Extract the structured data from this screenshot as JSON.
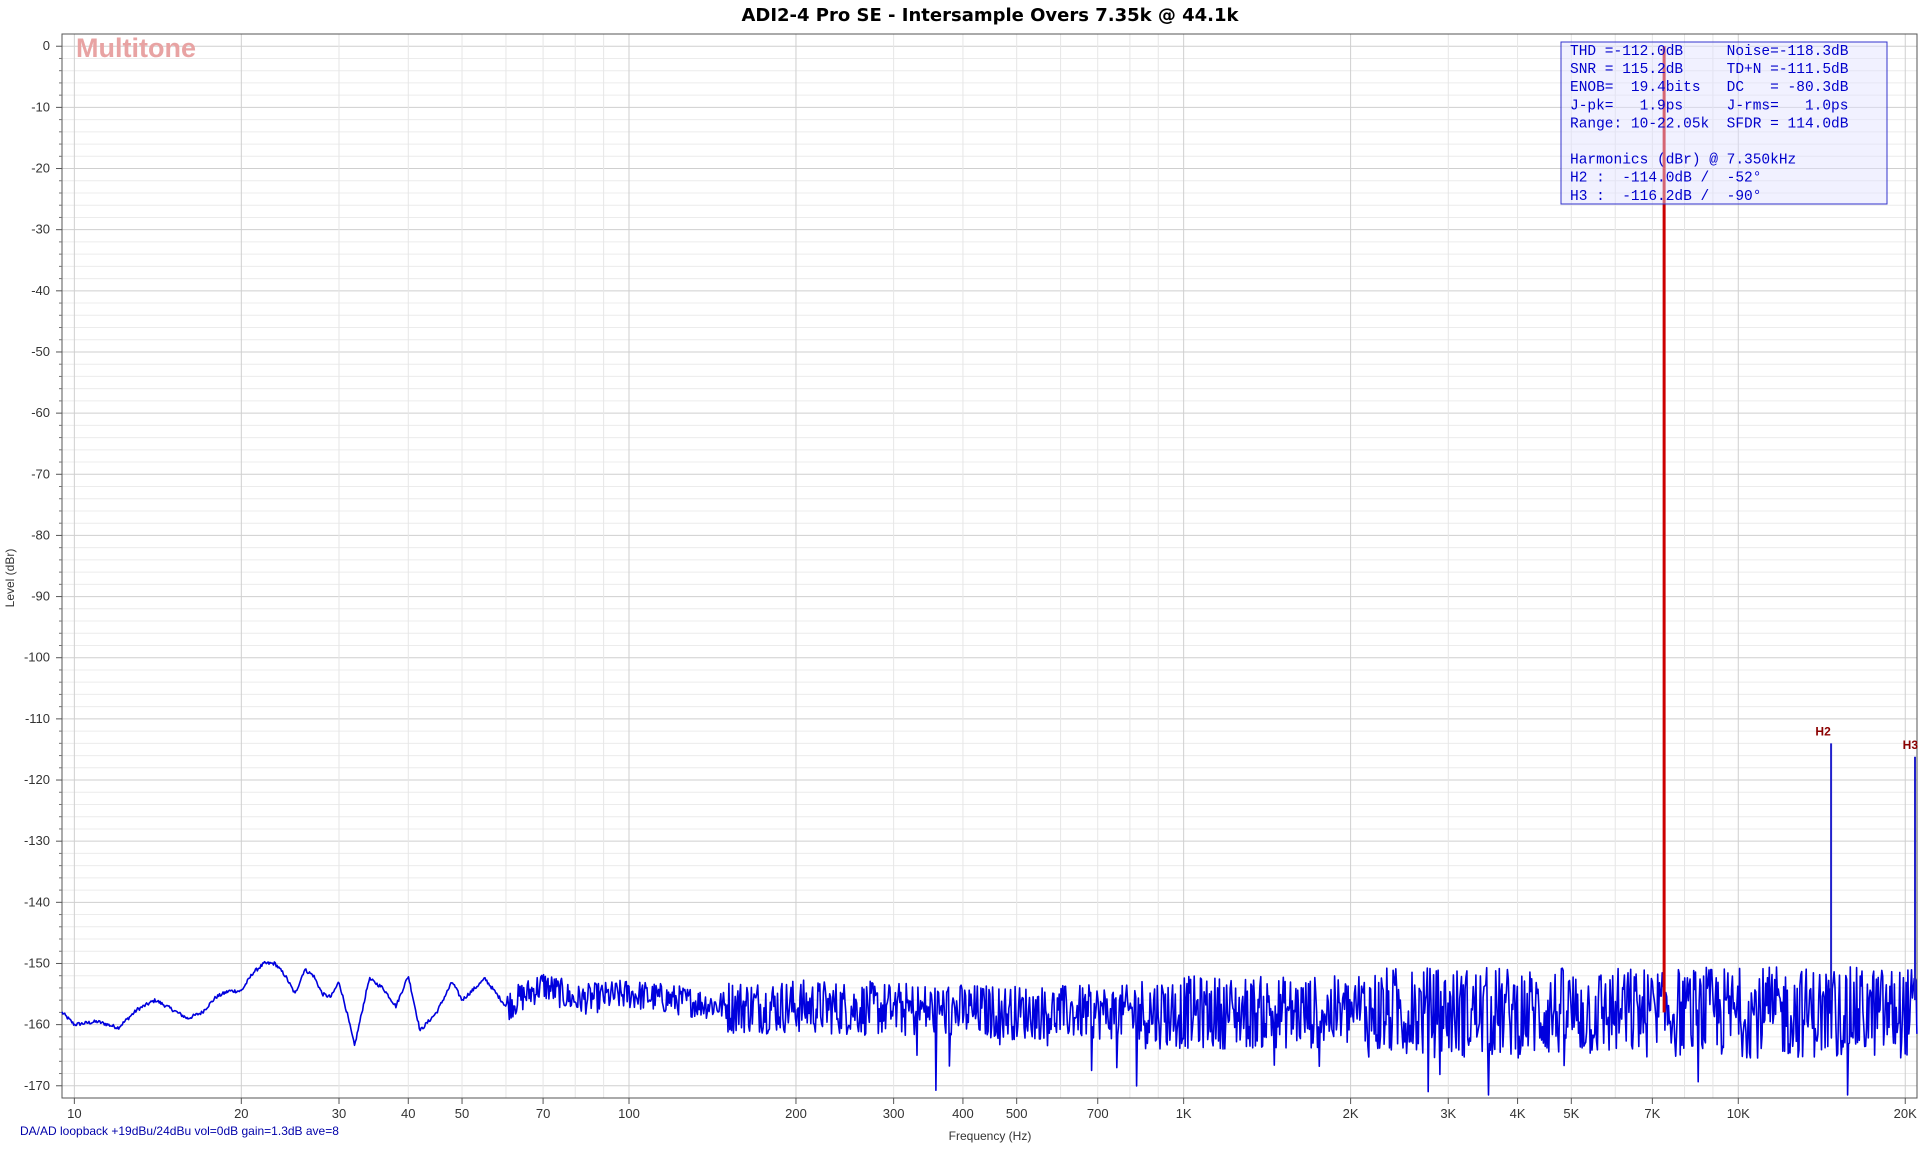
{
  "chart_data": {
    "type": "line",
    "title": "ADI2-4 Pro SE - Intersample Overs 7.35k @ 44.1k",
    "xlabel": "Frequency (Hz)",
    "ylabel": "Level (dBr)",
    "xscale": "log",
    "xlim": [
      9.5,
      21000
    ],
    "ylim": [
      -172,
      2
    ],
    "grid": true,
    "watermark": "Multitone",
    "footer": "DA/AD loopback +19dBu/24dBu vol=0dB gain=1.3dB ave=8",
    "x_ticks": [
      {
        "value": 10,
        "label": "10"
      },
      {
        "value": 20,
        "label": "20"
      },
      {
        "value": 30,
        "label": "30"
      },
      {
        "value": 40,
        "label": "40"
      },
      {
        "value": 50,
        "label": "50"
      },
      {
        "value": 70,
        "label": "70"
      },
      {
        "value": 100,
        "label": "100"
      },
      {
        "value": 200,
        "label": "200"
      },
      {
        "value": 300,
        "label": "300"
      },
      {
        "value": 400,
        "label": "400"
      },
      {
        "value": 500,
        "label": "500"
      },
      {
        "value": 700,
        "label": "700"
      },
      {
        "value": 1000,
        "label": "1K"
      },
      {
        "value": 2000,
        "label": "2K"
      },
      {
        "value": 3000,
        "label": "3K"
      },
      {
        "value": 4000,
        "label": "4K"
      },
      {
        "value": 5000,
        "label": "5K"
      },
      {
        "value": 7000,
        "label": "7K"
      },
      {
        "value": 10000,
        "label": "10K"
      },
      {
        "value": 20000,
        "label": "20K"
      }
    ],
    "y_ticks": [
      0,
      -10,
      -20,
      -30,
      -40,
      -50,
      -60,
      -70,
      -80,
      -90,
      -100,
      -110,
      -120,
      -130,
      -140,
      -150,
      -160,
      -170
    ],
    "series": [
      {
        "type": "noise_floor",
        "color": "#0000dd",
        "x": [
          9.5,
          10,
          11,
          12,
          13,
          14,
          15,
          16,
          17,
          18,
          19,
          20,
          21,
          22,
          23,
          24,
          25,
          26,
          27,
          28,
          29,
          30,
          31,
          32,
          34,
          36,
          38,
          40,
          42,
          45,
          48,
          50,
          55,
          60,
          70,
          80,
          100,
          150,
          200,
          300,
          500,
          1000,
          2000,
          5000,
          10000,
          20000,
          21000
        ],
        "y": [
          -158,
          -160,
          -159.5,
          -160.5,
          -157.5,
          -156,
          -157.5,
          -159,
          -158,
          -155.5,
          -154.5,
          -154.5,
          -151.5,
          -150,
          -150,
          -152,
          -155,
          -151,
          -152,
          -155,
          -155.5,
          -153,
          -158,
          -163.5,
          -152.5,
          -154,
          -157,
          -152,
          -161,
          -158,
          -153,
          -156,
          -152.5,
          -157,
          -153.5,
          -156,
          -155,
          -157,
          -157,
          -157.5,
          -158,
          -158,
          -158,
          -158,
          -158,
          -158,
          -158
        ]
      }
    ],
    "fundamental": {
      "freq": 7350,
      "level": 0,
      "color": "#cc0000"
    },
    "harmonics_marks": [
      {
        "label": "H2",
        "freq": 14700,
        "level": -114.0
      },
      {
        "label": "H3",
        "freq": 22050,
        "level": -116.2
      }
    ],
    "stats_box": {
      "lines": [
        "THD =-112.0dB     Noise=-118.3dB",
        "SNR = 115.2dB     TD+N =-111.5dB",
        "ENOB=  19.4bits   DC   = -80.3dB",
        "J-pk=   1.9ps     J-rms=   1.0ps",
        "Range: 10-22.05k  SFDR = 114.0dB",
        "",
        "Harmonics (dBr) @ 7.350kHz",
        "H2 :  -114.0dB /  -52°",
        "H3 :  -116.2dB /  -90°"
      ]
    }
  }
}
